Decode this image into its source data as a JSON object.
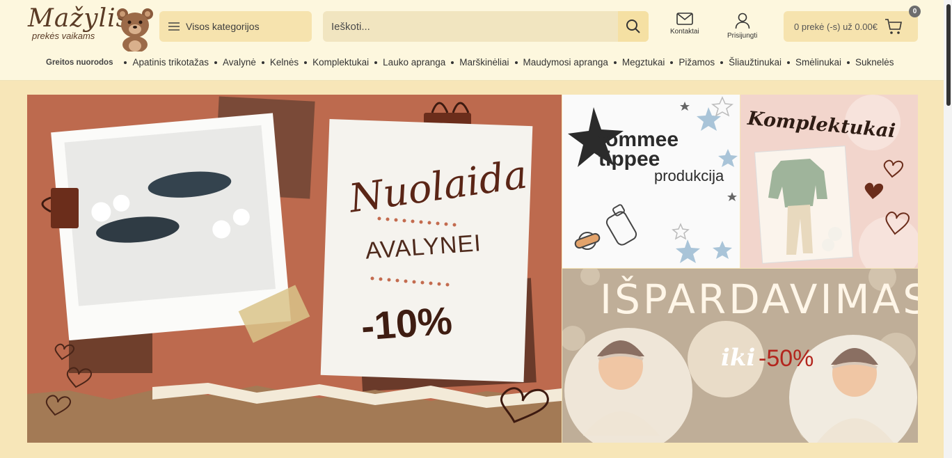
{
  "brand": {
    "name": "Mažylis",
    "tagline": "prekės vaikams"
  },
  "header": {
    "categories_label": "Visos kategorijos",
    "search_placeholder": "Ieškoti...",
    "contact_label": "Kontaktai",
    "login_label": "Prisijungti",
    "cart_label": "0 prekė (-s) už 0.00€",
    "cart_count": "0"
  },
  "quicknav": {
    "title": "Greitos nuorodos",
    "items": [
      "Apatinis trikotažas",
      "Avalynė",
      "Kelnės",
      "Komplektukai",
      "Lauko apranga",
      "Marškinėliai",
      "Maudymosi apranga",
      "Megztukai",
      "Pižamos",
      "Šliaužtinukai",
      "Smėlinukai",
      "Suknelės"
    ]
  },
  "banners": {
    "main": {
      "script": "Nuolaida",
      "title": "AVALYNEI",
      "discount": "-10%"
    },
    "tommee": {
      "brand1": "tommee",
      "brand2": "tippee",
      "sub": "produkcija"
    },
    "komplektukai": {
      "title": "Komplektukai"
    },
    "sale": {
      "title": "IŠPARDAVIMAS",
      "iki": "iki",
      "discount": "-50%"
    }
  },
  "colors": {
    "header_bg": "#fdf7de",
    "page_bg": "#f7e6b8",
    "accent": "#f6e3ae",
    "main_banner": "#bd6a4e"
  }
}
